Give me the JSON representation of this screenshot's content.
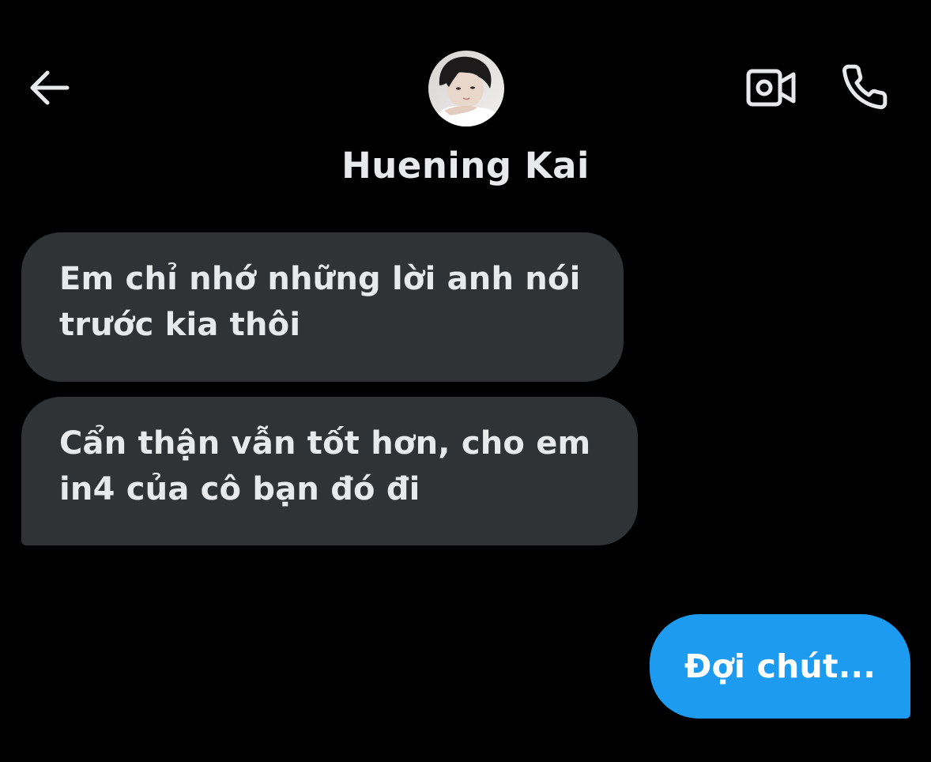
{
  "header": {
    "back_icon": "arrow-left-icon",
    "video_icon": "video-camera-icon",
    "phone_icon": "phone-icon",
    "contact_name": "Huening Kai"
  },
  "messages": [
    {
      "direction": "incoming",
      "lines": [
        "Em chỉ nhớ những lời anh nói",
        "trước kia thôi"
      ]
    },
    {
      "direction": "incoming",
      "lines": [
        "Cẩn thận vẫn tốt hơn, cho em",
        "in4 của cô bạn đó đi"
      ]
    },
    {
      "direction": "outgoing",
      "text": "Đợi chút..."
    }
  ],
  "colors": {
    "background": "#000000",
    "incoming_bubble": "#2f3336",
    "outgoing_bubble": "#1d9bf0",
    "text": "#e7e9ea"
  }
}
